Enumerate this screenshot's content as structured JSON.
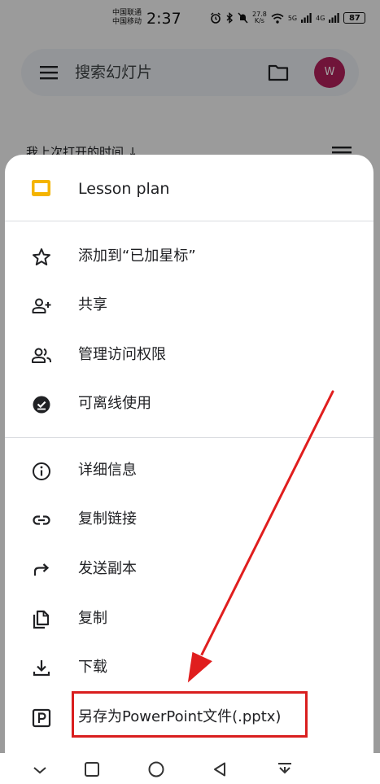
{
  "status_bar": {
    "carrier_1": "中国联通",
    "carrier_2": "中国移动",
    "time": "2:37",
    "net_speed_value": "27.8",
    "net_speed_unit": "K/s",
    "net_5g": "5G",
    "net_4g": "4G",
    "battery": "87"
  },
  "background": {
    "search_placeholder": "搜索幻灯片",
    "avatar_initial": "W",
    "sort_label": "我上次打开的时间 ↓",
    "avatar_color": "#b0205a"
  },
  "sheet": {
    "file_title": "Lesson plan",
    "file_icon_color": "#f4b400",
    "groups": [
      [
        {
          "label": "添加到“已加星标”",
          "icon": "star-icon"
        },
        {
          "label": "共享",
          "icon": "add-person-icon"
        },
        {
          "label": "管理访问权限",
          "icon": "people-icon"
        },
        {
          "label": "可离线使用",
          "icon": "offline-check-icon"
        }
      ],
      [
        {
          "label": "详细信息",
          "icon": "info-icon"
        },
        {
          "label": "复制链接",
          "icon": "link-icon"
        },
        {
          "label": "发送副本",
          "icon": "forward-arrow-icon"
        },
        {
          "label": "复制",
          "icon": "copy-icon"
        },
        {
          "label": "下载",
          "icon": "download-icon"
        },
        {
          "label": "另存为PowerPoint文件(.pptx)",
          "icon": "powerpoint-icon"
        }
      ]
    ]
  },
  "annotation": {
    "highlight_color": "#d91e1e"
  },
  "nav_bar": {
    "buttons": [
      "collapse-icon",
      "home-square-icon",
      "home-circle-icon",
      "back-triangle-icon",
      "notification-pull-icon"
    ]
  }
}
